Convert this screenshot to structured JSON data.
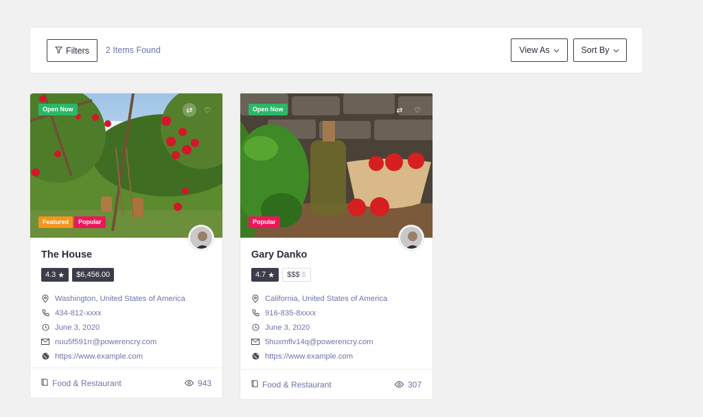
{
  "toolbar": {
    "filters_label": "Filters",
    "items_found": "2 Items Found",
    "view_as_label": "View As",
    "sort_by_label": "Sort By"
  },
  "listings": [
    {
      "title": "The House",
      "badges": {
        "open": "Open Now",
        "featured": "Featured",
        "popular": "Popular"
      },
      "rating": "4.3",
      "price": "$6,456.00",
      "location": "Washington, United States of America",
      "phone": "434-812-xxxx",
      "date": "June 3, 2020",
      "email": "nuu5f591rr@powerencry.com",
      "website": "https://www.example.com",
      "category": "Food & Restaurant",
      "views": "943"
    },
    {
      "title": "Gary Danko",
      "badges": {
        "open": "Open Now",
        "popular": "Popular"
      },
      "rating": "4.7",
      "price_level_active": "$$$",
      "price_level_inactive": "$",
      "location": "California, United States of America",
      "phone": "916-835-8xxxx",
      "date": "June 3, 2020",
      "email": "5huxmflv14q@powerencry.com",
      "website": "https://www.example.com",
      "category": "Food & Restaurant",
      "views": "307"
    }
  ],
  "colors": {
    "open": "#2ab868",
    "featured": "#f6941e",
    "popular": "#f0155b",
    "link": "#6d73a8",
    "dark_pill": "#3b3d4a"
  },
  "icons": [
    "filter-icon",
    "chevron-down-icon",
    "shuffle-icon",
    "heart-icon",
    "map-pin-icon",
    "phone-icon",
    "clock-icon",
    "mail-icon",
    "globe-icon",
    "book-icon",
    "eye-icon",
    "star-icon"
  ]
}
